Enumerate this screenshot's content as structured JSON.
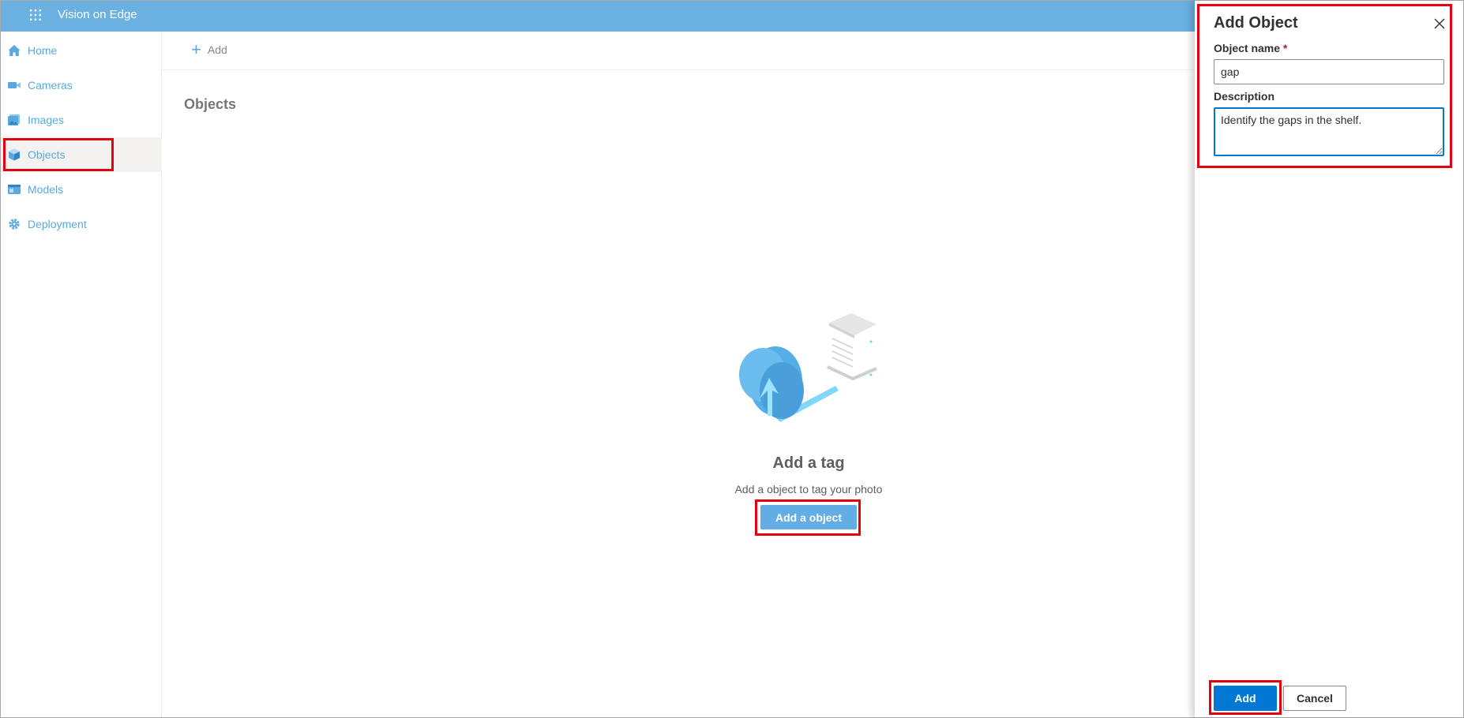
{
  "app": {
    "title": "Vision on Edge"
  },
  "sidebar": {
    "items": [
      {
        "label": "Home",
        "icon": "home-icon"
      },
      {
        "label": "Cameras",
        "icon": "camera-icon"
      },
      {
        "label": "Images",
        "icon": "images-icon"
      },
      {
        "label": "Objects",
        "icon": "cube-icon",
        "active": true
      },
      {
        "label": "Models",
        "icon": "model-icon"
      },
      {
        "label": "Deployment",
        "icon": "gear-icon"
      }
    ]
  },
  "commandbar": {
    "add_label": "Add",
    "add_icon": "plus-icon"
  },
  "main": {
    "title": "Objects",
    "empty_state": {
      "title": "Add a tag",
      "subtitle": "Add a object to tag your photo",
      "button_label": "Add a object",
      "illustration": "cloud-upload-illustration"
    }
  },
  "panel": {
    "title": "Add Object",
    "name_label": "Object name",
    "required_marker": "*",
    "name_value": "gap",
    "description_label": "Description",
    "description_value": "Identify the gaps in the shelf.",
    "add_button": "Add",
    "cancel_button": "Cancel",
    "close_icon": "close-icon"
  },
  "colors": {
    "topbar": "#6ab0e0",
    "nav_text": "#5aa9de",
    "primary": "#0078d4",
    "highlight": "#e3000f"
  }
}
